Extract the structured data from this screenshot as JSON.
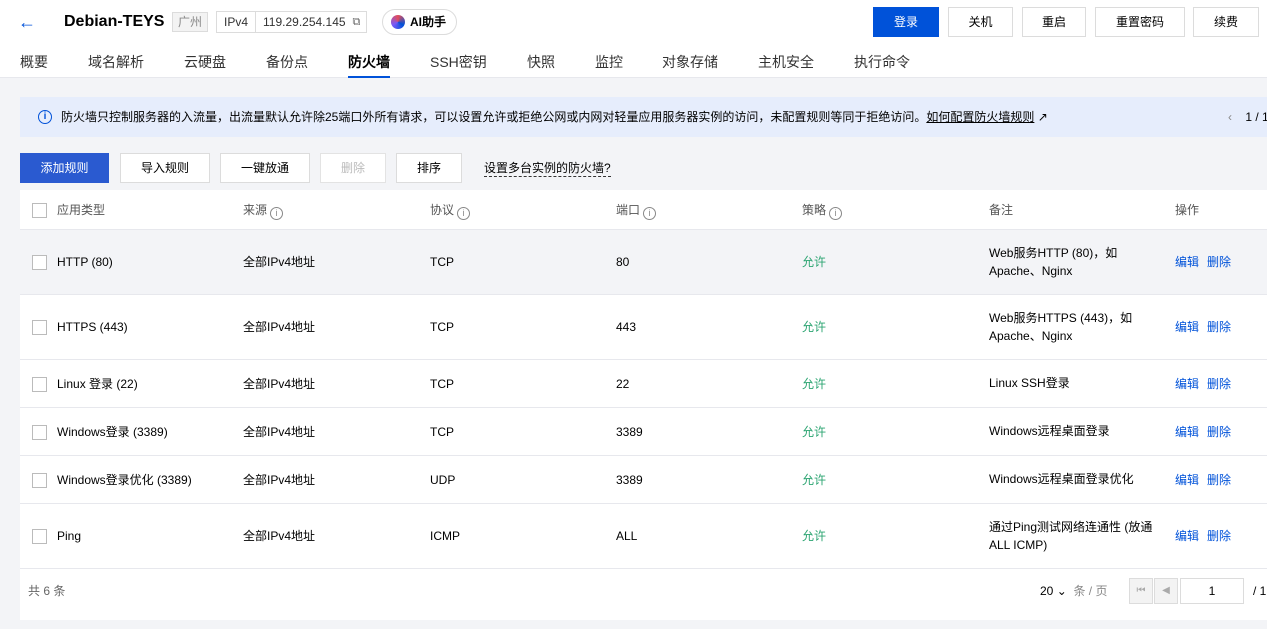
{
  "header": {
    "title": "Debian-TEYS",
    "region": "广州",
    "ip_version": "IPv4",
    "ip_address": "119.29.254.145",
    "ai_label": "AI助手",
    "buttons": {
      "login": "登录",
      "shutdown": "关机",
      "restart": "重启",
      "reset_password": "重置密码",
      "renew": "续费"
    }
  },
  "tabs": [
    "概要",
    "域名解析",
    "云硬盘",
    "备份点",
    "防火墙",
    "SSH密钥",
    "快照",
    "监控",
    "对象存储",
    "主机安全",
    "执行命令"
  ],
  "active_tab": "防火墙",
  "banner": {
    "text": "防火墙只控制服务器的入流量，出流量默认允许除25端口外所有请求，可以设置允许或拒绝公网或内网对轻量应用服务器实例的访问，未配置规则等同于拒绝访问。",
    "link": "如何配置防火墙规则",
    "page": "1 / 1"
  },
  "actions": {
    "add": "添加规则",
    "import": "导入规则",
    "one_click": "一键放通",
    "delete": "删除",
    "sort": "排序",
    "multi_instance": "设置多台实例的防火墙?"
  },
  "table": {
    "headers": [
      "应用类型",
      "来源",
      "协议",
      "端口",
      "策略",
      "备注",
      "操作"
    ],
    "rows": [
      {
        "type": "HTTP (80)",
        "source": "全部IPv4地址",
        "protocol": "TCP",
        "port": "80",
        "policy": "允许",
        "note1": "Web服务HTTP (80)，如",
        "note2": "Apache、Nginx"
      },
      {
        "type": "HTTPS (443)",
        "source": "全部IPv4地址",
        "protocol": "TCP",
        "port": "443",
        "policy": "允许",
        "note1": "Web服务HTTPS (443)，如",
        "note2": "Apache、Nginx"
      },
      {
        "type": "Linux 登录 (22)",
        "source": "全部IPv4地址",
        "protocol": "TCP",
        "port": "22",
        "policy": "允许",
        "note1": "Linux SSH登录",
        "note2": ""
      },
      {
        "type": "Windows登录 (3389)",
        "source": "全部IPv4地址",
        "protocol": "TCP",
        "port": "3389",
        "policy": "允许",
        "note1": "Windows远程桌面登录",
        "note2": ""
      },
      {
        "type": "Windows登录优化 (3389)",
        "source": "全部IPv4地址",
        "protocol": "UDP",
        "port": "3389",
        "policy": "允许",
        "note1": "Windows远程桌面登录优化",
        "note2": ""
      },
      {
        "type": "Ping",
        "source": "全部IPv4地址",
        "protocol": "ICMP",
        "port": "ALL",
        "policy": "允许",
        "note1": "通过Ping测试网络连通性 (放通",
        "note2": "ALL ICMP)"
      }
    ],
    "edit_label": "编辑",
    "delete_label": "删除"
  },
  "footer": {
    "total": "共 6 条",
    "page_size": "20",
    "page_size_unit": "条 / 页",
    "current_page": "1",
    "total_pages": "/ 1"
  },
  "colors": {
    "primary": "#0052d9",
    "allow": "#2ba471",
    "banner_bg": "#e6edfc"
  }
}
